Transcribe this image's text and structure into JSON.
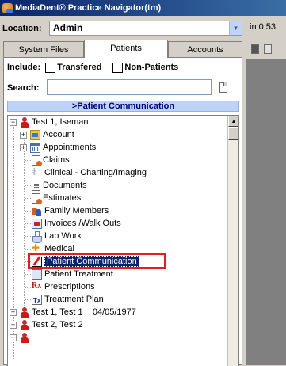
{
  "window": {
    "title": "MediaDent® Practice Navigator(tm)",
    "app_icon": "app-icon"
  },
  "location": {
    "label": "Location:",
    "value": "Admin"
  },
  "tabs": [
    {
      "label": "System Files",
      "active": false
    },
    {
      "label": "Patients",
      "active": true
    },
    {
      "label": "Accounts",
      "active": false
    }
  ],
  "filters": {
    "include_label": "Include:",
    "transferred_label": "Transfered",
    "non_patients_label": "Non-Patients",
    "transferred_checked": false,
    "non_patients_checked": false
  },
  "search": {
    "label": "Search:",
    "value": ""
  },
  "section_header": ">Patient Communication",
  "tree": {
    "patient1": "Test 1, Iseman",
    "items": [
      {
        "label": "Account",
        "icon": "account-icon"
      },
      {
        "label": "Appointments",
        "icon": "calendar-icon"
      },
      {
        "label": "Claims",
        "icon": "claims-icon"
      },
      {
        "label": "Clinical - Charting/Imaging",
        "icon": "tooth-icon"
      },
      {
        "label": "Documents",
        "icon": "document-icon"
      },
      {
        "label": "Estimates",
        "icon": "estimates-icon"
      },
      {
        "label": "Family Members",
        "icon": "family-icon"
      },
      {
        "label": "Invoices /Walk Outs",
        "icon": "invoice-icon"
      },
      {
        "label": "Lab Work",
        "icon": "flask-icon"
      },
      {
        "label": "Medical",
        "icon": "medical-icon"
      },
      {
        "label": "Patient Communication",
        "icon": "communication-icon",
        "selected": true
      },
      {
        "label": "Patient Treatment",
        "icon": "treatment-icon"
      },
      {
        "label": "Prescriptions",
        "icon": "rx-icon"
      },
      {
        "label": "Treatment Plan",
        "icon": "treatment-plan-icon"
      }
    ],
    "patient2": "Test 1, Test 1    04/05/1977",
    "patient3": "Test 2, Test 2"
  },
  "right_panel": {
    "version_text": "in 0.53"
  },
  "colors": {
    "highlight_red": "#e41e1e",
    "selection_blue": "#0a246a",
    "header_blue": "#bcd3f5"
  }
}
